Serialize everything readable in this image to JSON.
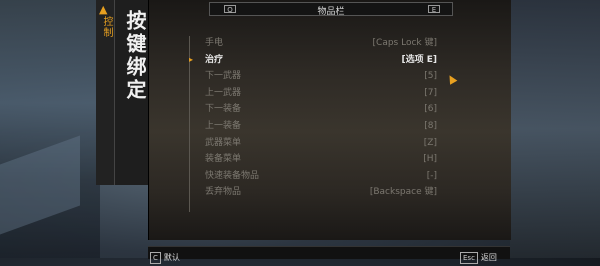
{
  "side_tab": {
    "arrow": "▲",
    "label": "控制"
  },
  "title_panel": {
    "title": "按键绑定"
  },
  "topbar": {
    "left_key": "Q",
    "title": "物品栏",
    "right_key": "E"
  },
  "bindings": [
    {
      "action": "手电",
      "key": "[Caps Lock 键]",
      "active": false
    },
    {
      "action": "治疗",
      "key": "[选项 E]",
      "active": true
    },
    {
      "action": "下一武器",
      "key": "[5]",
      "active": false
    },
    {
      "action": "上一武器",
      "key": "[7]",
      "active": false
    },
    {
      "action": "下一装备",
      "key": "[6]",
      "active": false
    },
    {
      "action": "上一装备",
      "key": "[8]",
      "active": false
    },
    {
      "action": "武器菜单",
      "key": "[Z]",
      "active": false
    },
    {
      "action": "装备菜单",
      "key": "[H]",
      "active": false
    },
    {
      "action": "快速装备物品",
      "key": "[-]",
      "active": false
    },
    {
      "action": "丢弃物品",
      "key": "[Backspace 键]",
      "active": false
    }
  ],
  "marker": "▸",
  "footer": {
    "left_key": "C",
    "left_label": "默认",
    "right_key": "Esc",
    "right_label": "返回"
  },
  "colors": {
    "accent": "#e8a020",
    "active_text": "#e6e6e6",
    "inactive_text": "#7c7870"
  },
  "icons": {
    "cursor": "arrow-cursor-icon",
    "marker": "selection-marker-icon"
  }
}
